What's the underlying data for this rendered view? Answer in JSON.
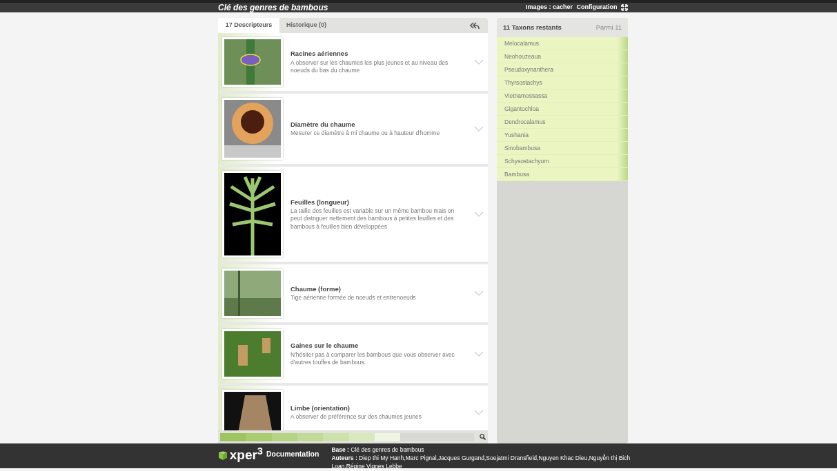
{
  "top_bar": {
    "title": "Clé des genres de bambous",
    "links": [
      "Images : cacher",
      "Configuration"
    ]
  },
  "tabs": [
    {
      "label": "17 Descripteurs",
      "selected": true
    },
    {
      "label": "Historique (0)",
      "selected": false
    }
  ],
  "descriptors": [
    {
      "title": "Racines aériennes",
      "description": "A observer sur les chaumes les plus jeunes et au niveau des noeuds du bas du chaume",
      "kind": "stem"
    },
    {
      "title": "Diamètre du chaume",
      "description": "Mesurer ce diamètre à mi chaume ou à hauteur d'homme",
      "kind": "section"
    },
    {
      "title": "Feuilles (longueur)",
      "description": "La taille des feuilles est variable sur un même bambou mais on peut distnguer nettement des bambous à petites feuilles et des bambous à feuilles bien développées",
      "kind": "leaf"
    },
    {
      "title": "Chaume (forme)",
      "description": "Tige aérienne formée de noeuds et entrenoeuds",
      "kind": "clump"
    },
    {
      "title": "Gaines sur le chaume",
      "description": "N'hésiter pas à comparer les bambous que vous observer avec d'autres touffes de bambous.",
      "kind": "sheath"
    },
    {
      "title": "Limbe (orientation)",
      "description": "A observer de préférence sur des chaumes jeunes",
      "kind": "blade"
    }
  ],
  "progress": {
    "level": 0.71
  },
  "taxa_panel": {
    "title": "11 Taxons restants",
    "count": "Parmi 11",
    "taxa": [
      "Melocalamus",
      "Neohouzeaua",
      "Pseudoxynanthera",
      "Thyrsostachys",
      "Vietnamossassa",
      "Gigantochloa",
      "Dendrocalamus",
      "Yushania",
      "Sinobambusa",
      "Schysostachyum",
      "Bambusa"
    ]
  },
  "footer": {
    "logo": "xper",
    "logo_sup": "3",
    "documentation": "Documentation",
    "base_label": "Base :",
    "base": "Clé des genres de bambous",
    "authors_label": "Auteurs :",
    "authors": "Diep thi My Hanh,Marc Pignal,Jacques Gurgand,Soejatmi Dransfield,Nguyen Khac Dieu,Nguyễn thị Bich Loan,Régine Vignes Lebbe"
  }
}
